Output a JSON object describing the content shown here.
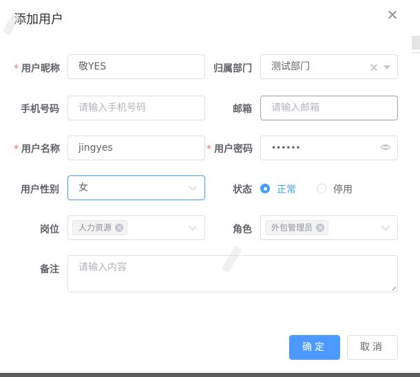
{
  "dialog": {
    "title": "添加用户",
    "fields": {
      "nickname": {
        "label": "用户昵称",
        "value": "敬YES"
      },
      "department": {
        "label": "归属部门",
        "value": "测试部门"
      },
      "phone": {
        "label": "手机号码",
        "placeholder": "请输入手机号码"
      },
      "email": {
        "label": "邮箱",
        "placeholder": "请输入邮箱"
      },
      "username": {
        "label": "用户名称",
        "value": "jingyes"
      },
      "password": {
        "label": "用户密码",
        "value": "••••••"
      },
      "gender": {
        "label": "用户性别",
        "value": "女"
      },
      "status": {
        "label": "状态",
        "options": [
          "正常",
          "停用"
        ],
        "selected": "正常"
      },
      "post": {
        "label": "岗位",
        "tags": [
          "人力资源"
        ]
      },
      "role": {
        "label": "角色",
        "tags": [
          "外包管理员"
        ]
      },
      "remark": {
        "label": "备注",
        "placeholder": "请输入内容"
      }
    },
    "buttons": {
      "confirm": "确定",
      "cancel": "取消"
    }
  },
  "colors": {
    "primary": "#409eff",
    "required": "#f56c6c",
    "confirm_button": "#4c9aff"
  }
}
